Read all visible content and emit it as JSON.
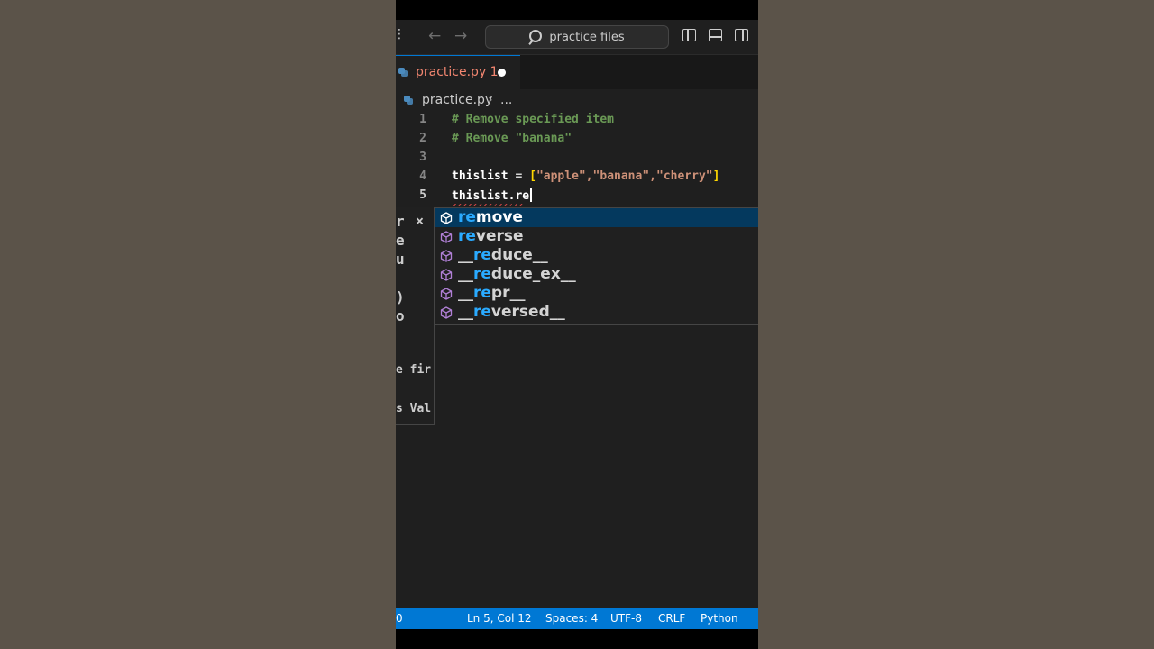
{
  "titlebar": {
    "search_text": "practice files"
  },
  "tab": {
    "filename": "practice.py 1"
  },
  "breadcrumb": {
    "file": "practice.py",
    "separator": "›",
    "more": "..."
  },
  "code": {
    "line_numbers": [
      "1",
      "2",
      "3",
      "4",
      "5"
    ],
    "line1": "# Remove specified item",
    "line2": "# Remove \"banana\"",
    "line4": {
      "var": "thislist",
      "op": " = ",
      "open": "[",
      "items": "\"apple\",\"banana\",\"cherry\"",
      "close": "]"
    },
    "line5": "thislist.re"
  },
  "hover_fragments": [
    "r",
    "e",
    "u",
    ")",
    "o",
    "e fir",
    "s Val"
  ],
  "hover_close": "×",
  "suggestions": [
    {
      "match": "re",
      "rest": "move",
      "prefix": "",
      "icon": "method-cube-icon"
    },
    {
      "match": "re",
      "rest": "verse",
      "prefix": "",
      "icon": "method-cube-icon"
    },
    {
      "match": "re",
      "rest": "duce__",
      "prefix": "__",
      "icon": "method-cube-icon"
    },
    {
      "match": "re",
      "rest": "duce_ex__",
      "prefix": "__",
      "icon": "method-cube-icon"
    },
    {
      "match": "re",
      "rest": "pr__",
      "prefix": "__",
      "icon": "method-cube-icon"
    },
    {
      "match": "re",
      "rest": "versed__",
      "prefix": "__",
      "icon": "method-cube-icon"
    }
  ],
  "status": {
    "problems": "0",
    "position": "Ln 5, Col 12",
    "spaces": "Spaces: 4",
    "encoding": "UTF-8",
    "eol": "CRLF",
    "language": "Python"
  },
  "colors": {
    "accent": "#0078d4",
    "match_highlight": "#2aaaff",
    "selection": "#04395e"
  }
}
